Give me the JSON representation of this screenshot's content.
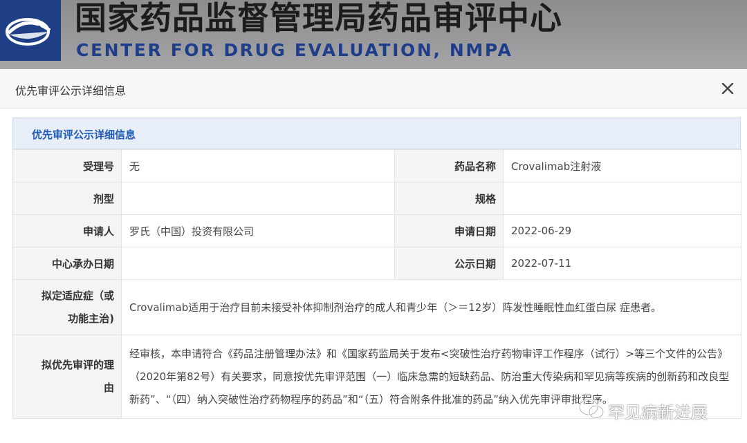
{
  "header": {
    "title_cn": "国家药品监督管理局药品审评中心",
    "title_en": "CENTER FOR DRUG EVALUATION, NMPA",
    "logo_icon": "cde-logo-icon"
  },
  "dialog": {
    "title": "优先审评公示详细信息",
    "close_icon": "close-icon",
    "section_title": "优先审评公示详细信息"
  },
  "fields": {
    "acceptance_no": {
      "label": "受理号",
      "value": "无"
    },
    "drug_name": {
      "label": "药品名称",
      "value": "Crovalimab注射液"
    },
    "dosage_form": {
      "label": "剂型",
      "value": ""
    },
    "specification": {
      "label": "规格",
      "value": ""
    },
    "applicant": {
      "label": "申请人",
      "value": "罗氏（中国）投资有限公司"
    },
    "application_date": {
      "label": "申请日期",
      "value": "2022-06-29"
    },
    "center_date": {
      "label": "中心承办日期",
      "value": ""
    },
    "publicity_date": {
      "label": "公示日期",
      "value": "2022-07-11"
    },
    "indication": {
      "label_line1": "拟定适应症（或",
      "label_line2": "功能主治)",
      "value": "Crovalimab适用于治疗目前未接受补体抑制剂治疗的成人和青少年（＞＝12岁）阵发性睡眠性血红蛋白尿 症患者。"
    },
    "reason": {
      "label_line1": "拟优先审评的理",
      "label_line2": "由",
      "value": "经审核，本申请符合《药品注册管理办法》和《国家药监局关于发布<突破性治疗药物审评工作程序（试行）>等三个文件的公告》（2020年第82号）有关要求，同意按优先审评范围（一）临床急需的短缺药品、防治重大传染病和罕见病等疾病的创新药和改良型新药”、“（四）纳入突破性治疗药物程序的药品”和“（五）符合附条件批准的药品”纳入优先审评审批程序。"
    }
  },
  "watermark": {
    "text": "罕见病新进展",
    "icon": "wechat-icon"
  }
}
